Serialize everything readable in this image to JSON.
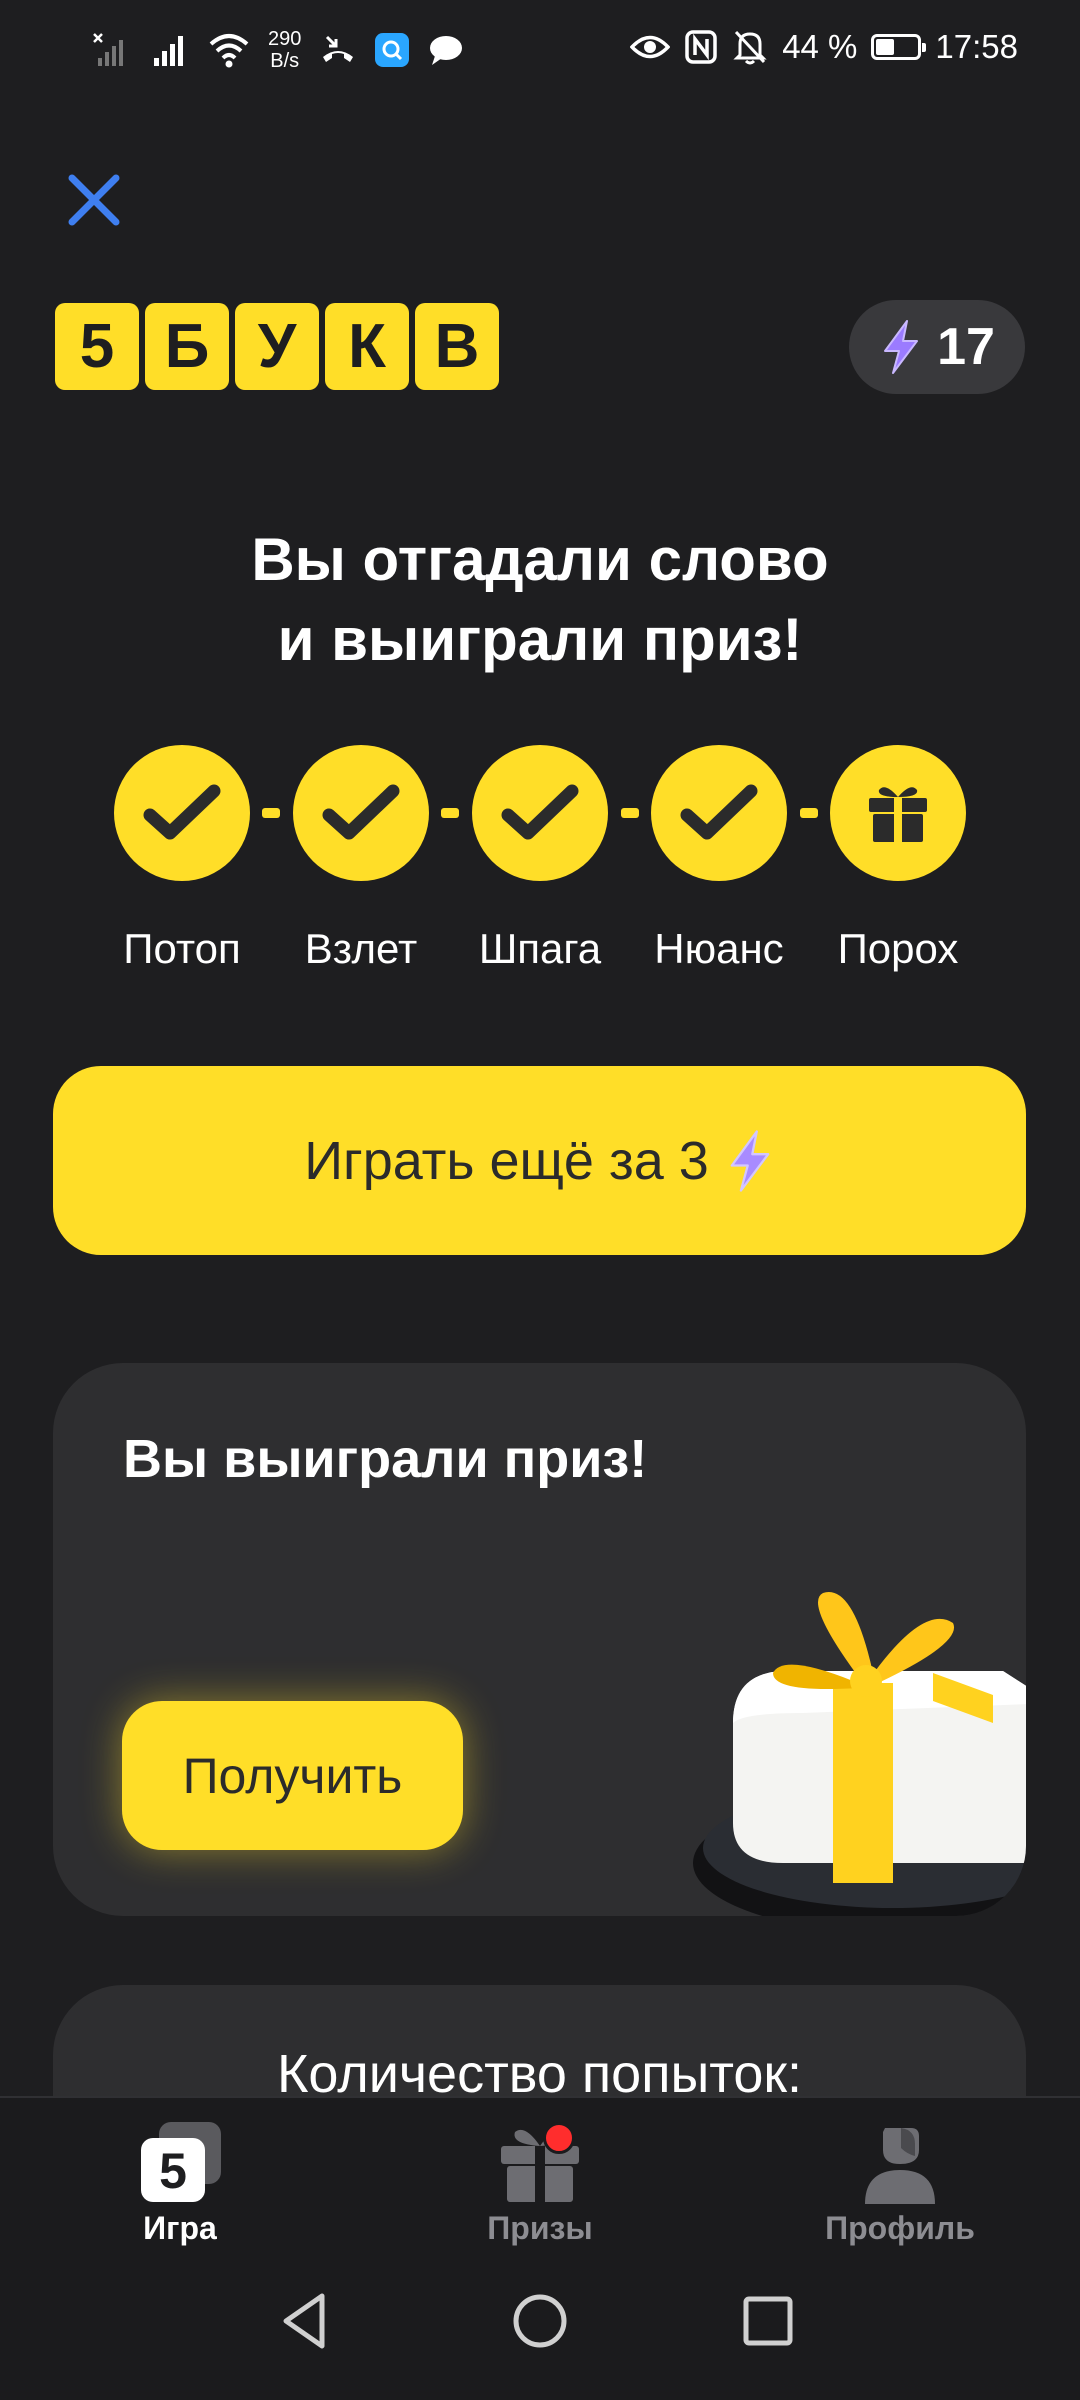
{
  "status_bar": {
    "net_speed_value": "290",
    "net_speed_unit": "B/s",
    "battery_text": "44 %",
    "battery_level": 0.44,
    "time": "17:58",
    "icons": [
      "no-sim-signal-icon",
      "signal-icon",
      "wifi-icon",
      "missed-call-icon",
      "messenger-app-icon",
      "chat-icon",
      "eye-icon",
      "nfc-icon",
      "muted-bell-icon",
      "battery-icon"
    ]
  },
  "header": {
    "logo_letters": [
      "5",
      "Б",
      "У",
      "К",
      "В"
    ],
    "energy_count": "17",
    "close_icon": "close-icon"
  },
  "headline": {
    "line1": "Вы отгадали слово",
    "line2": "и выиграли приз!"
  },
  "progress": {
    "steps": [
      {
        "word": "Потоп",
        "state": "done",
        "icon": "check-icon"
      },
      {
        "word": "Взлет",
        "state": "done",
        "icon": "check-icon"
      },
      {
        "word": "Шпага",
        "state": "done",
        "icon": "check-icon"
      },
      {
        "word": "Нюанс",
        "state": "done",
        "icon": "check-icon"
      },
      {
        "word": "Порох",
        "state": "prize",
        "icon": "gift-icon"
      }
    ]
  },
  "play_button": {
    "label": "Играть ещё за 3",
    "icon": "lightning-icon"
  },
  "prize_card": {
    "title": "Вы выиграли приз!",
    "button_label": "Получить"
  },
  "attempts_card": {
    "title": "Количество попыток:"
  },
  "bottom_nav": {
    "items": [
      {
        "label": "Игра",
        "icon": "game-5-icon",
        "active": true
      },
      {
        "label": "Призы",
        "icon": "gift-icon",
        "active": false,
        "has_badge": true
      },
      {
        "label": "Профиль",
        "icon": "profile-icon",
        "active": false
      }
    ]
  },
  "colors": {
    "background": "#1e1e20",
    "accent_yellow": "#ffde28",
    "card": "#2e2e30",
    "close_blue": "#3f7ff0",
    "lightning_purple": "#9b7bff",
    "badge_red": "#ff2d2d"
  }
}
